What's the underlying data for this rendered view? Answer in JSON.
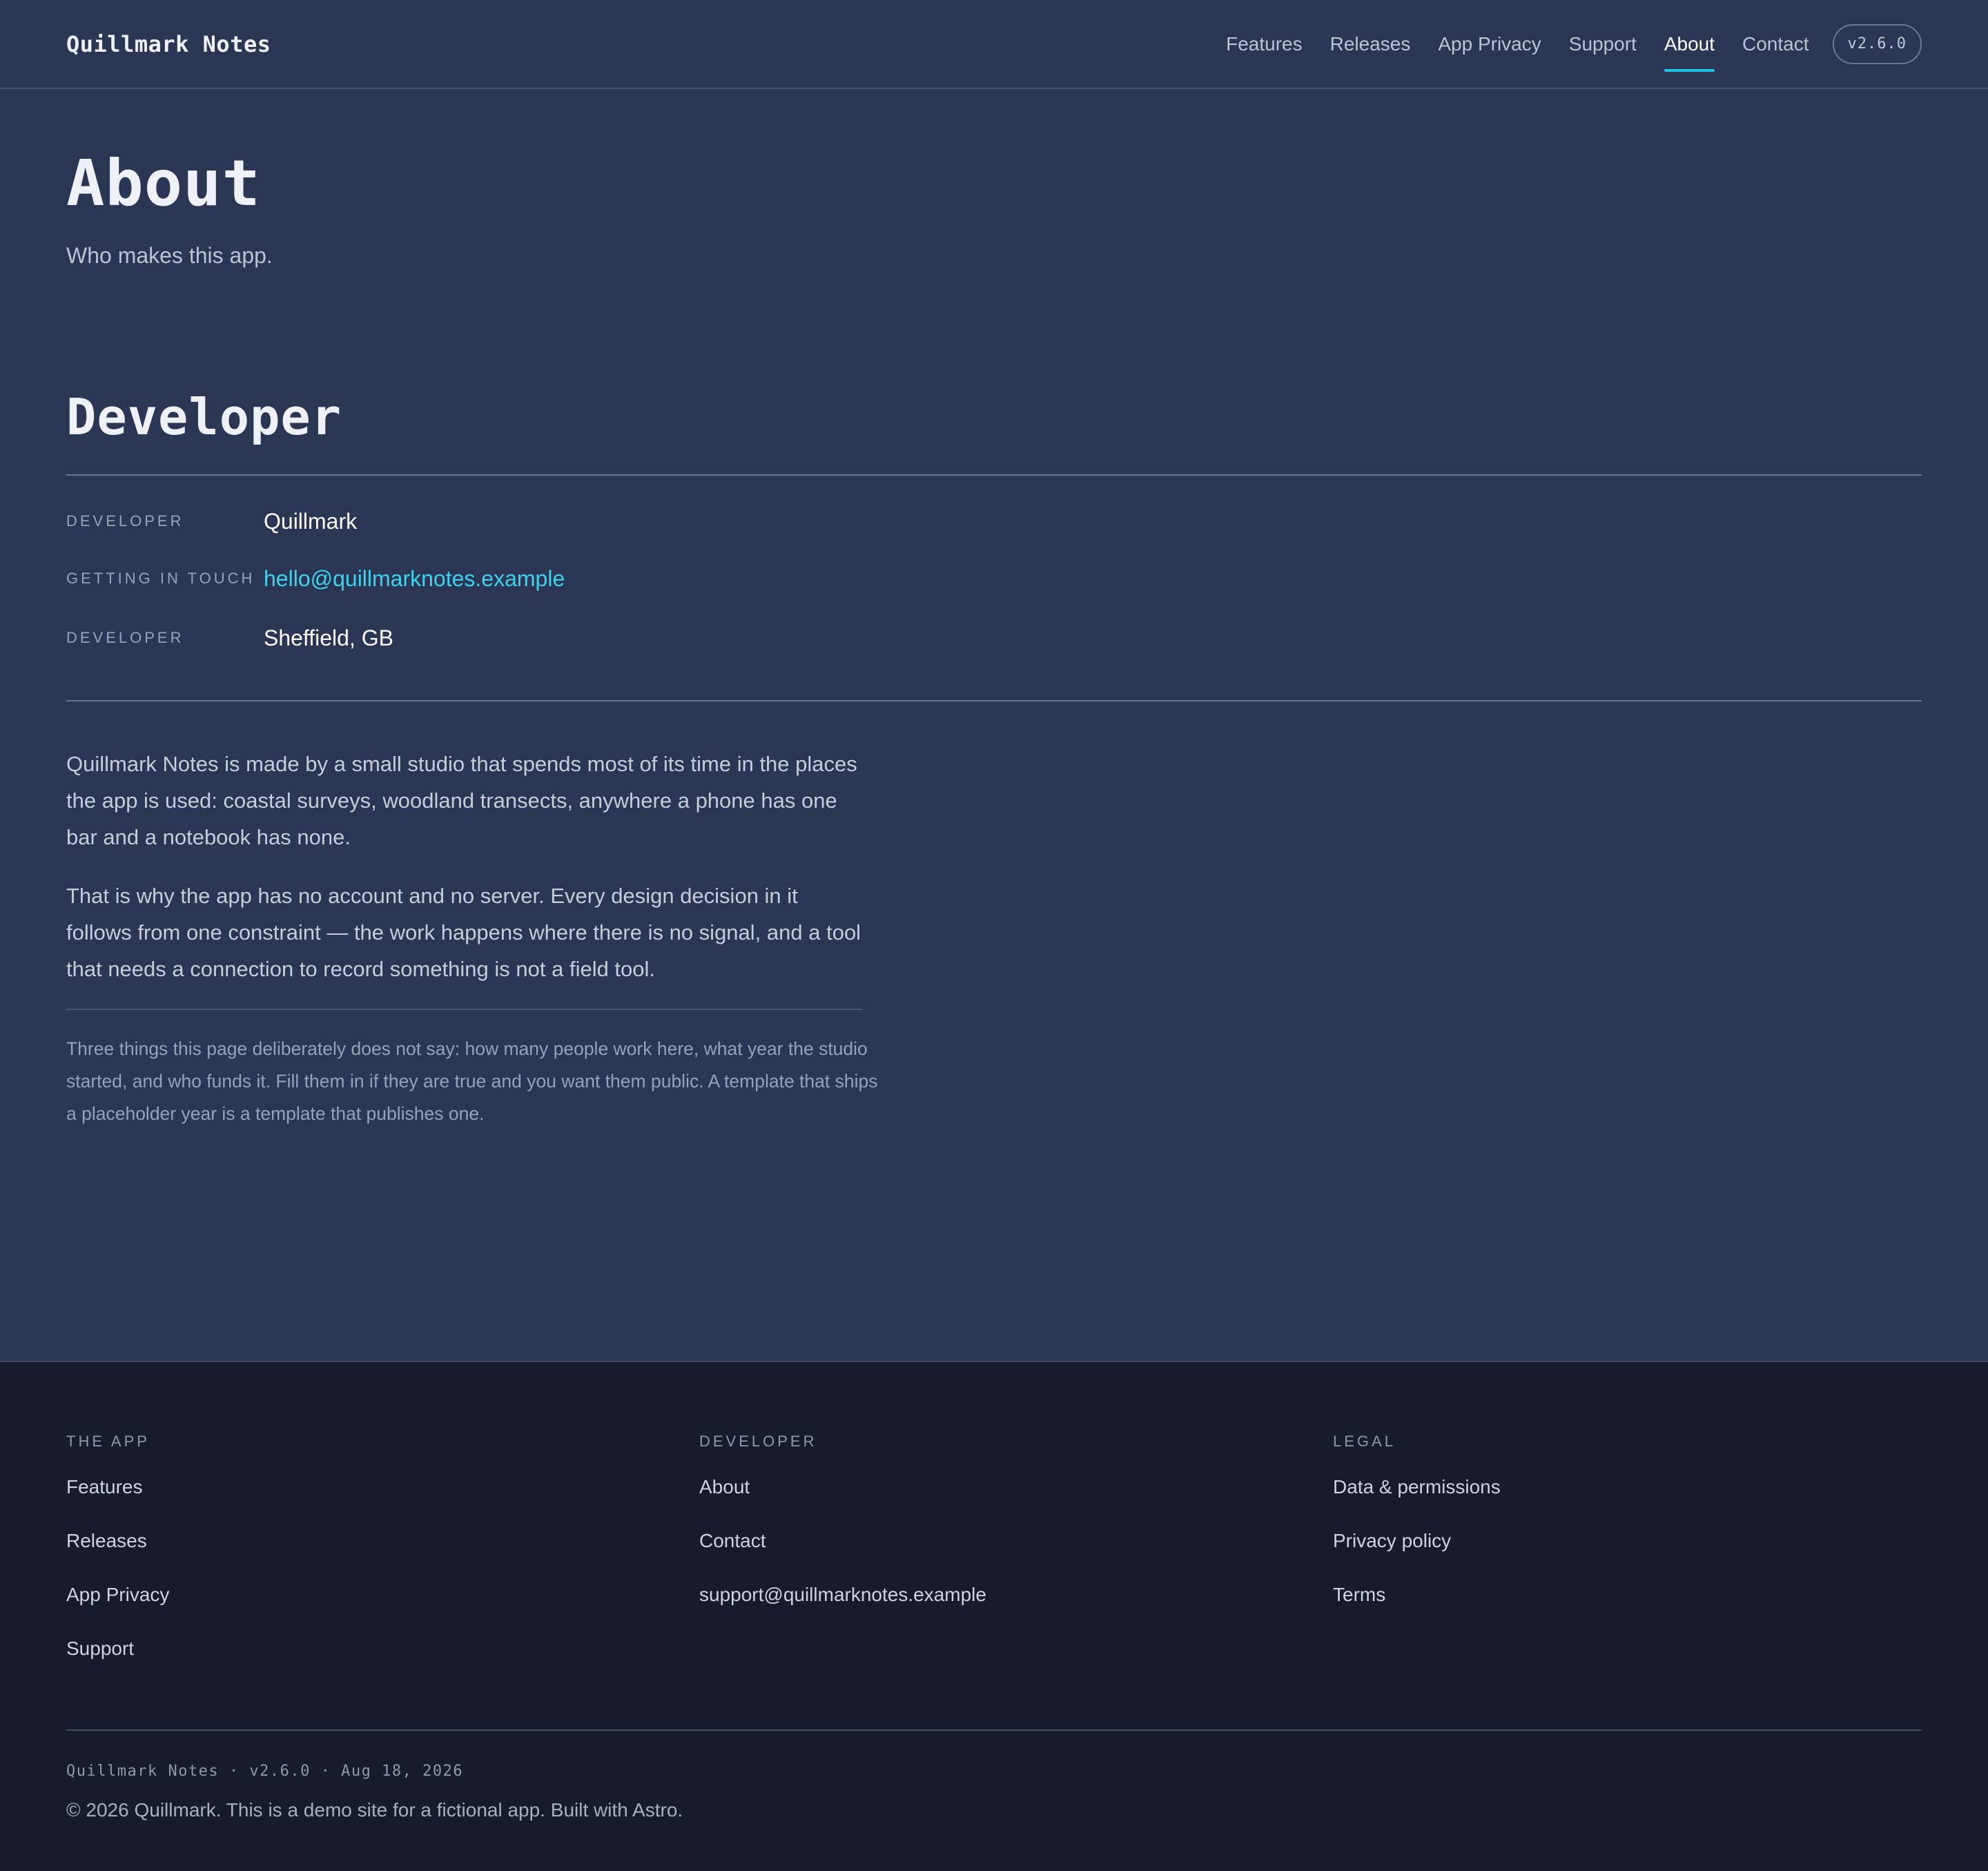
{
  "header": {
    "brand": "Quillmark Notes",
    "nav": [
      "Features",
      "Releases",
      "App Privacy",
      "Support",
      "About",
      "Contact"
    ],
    "active_nav": "About",
    "version": "v2.6.0"
  },
  "main": {
    "title": "About",
    "subtitle": "Who makes this app.",
    "section_title": "Developer",
    "info": [
      {
        "key": "Developer",
        "value": "Quillmark"
      },
      {
        "key": "Getting in touch",
        "value": "hello@quillmarknotes.example"
      },
      {
        "key": "Developer",
        "value": "Sheffield, GB"
      }
    ],
    "paragraphs": [
      "Quillmark Notes is made by a small studio that spends most of its time in the places the app is used: coastal surveys, woodland transects, anywhere a phone has one bar and a notebook has none.",
      "That is why the app has no account and no server. Every design decision in it follows from one constraint — the work happens where there is no signal, and a tool that needs a connection to record something is not a field tool."
    ],
    "note": "Three things this page deliberately does not say: how many people work here, what year the studio started, and who funds it. Fill them in if they are true and you want them public. A template that ships a placeholder year is a template that publishes one."
  },
  "footer": {
    "columns": [
      {
        "heading": "The app",
        "links": [
          "Features",
          "Releases",
          "App Privacy",
          "Support"
        ]
      },
      {
        "heading": "Developer",
        "links": [
          "About",
          "Contact",
          "support@quillmarknotes.example"
        ]
      },
      {
        "heading": "Legal",
        "links": [
          "Data & permissions",
          "Privacy policy",
          "Terms"
        ]
      }
    ],
    "meta": "Quillmark Notes · v2.6.0 · Aug 18, 2026",
    "copyright": "© 2026 Quillmark. This is a demo site for a fictional app. Built with Astro."
  },
  "colors": {
    "page_bg": "#2a3653",
    "footer_bg": "#161c2c",
    "accent": "#22c3e6",
    "link": "#3fd2ef"
  }
}
